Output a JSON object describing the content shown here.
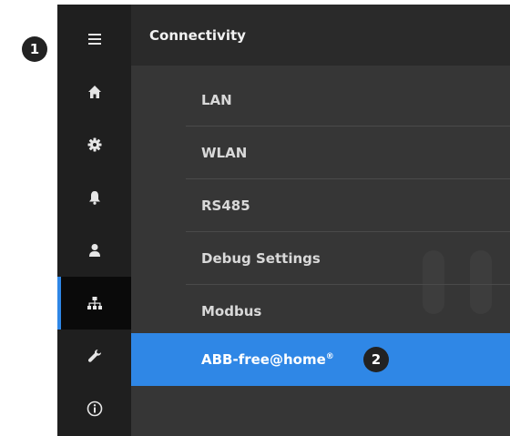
{
  "callouts": {
    "first": "1",
    "second": "2"
  },
  "rail": {
    "icons": [
      "menu-icon",
      "home-icon",
      "gear-icon",
      "bell-icon",
      "user-icon",
      "network-icon",
      "wrench-icon",
      "info-icon"
    ],
    "active_index": 5
  },
  "panel": {
    "title": "Connectivity",
    "items": [
      {
        "label": "LAN"
      },
      {
        "label": "WLAN"
      },
      {
        "label": "RS485"
      },
      {
        "label": "Debug Settings"
      },
      {
        "label": "Modbus"
      },
      {
        "label": "ABB-free@home",
        "reg_mark": "®",
        "selected": true
      }
    ]
  },
  "colors": {
    "accent": "#2f87e6",
    "rail_bg": "#1f1f1f",
    "panel_bg": "#363636",
    "header_bg": "#2a2a2a"
  }
}
